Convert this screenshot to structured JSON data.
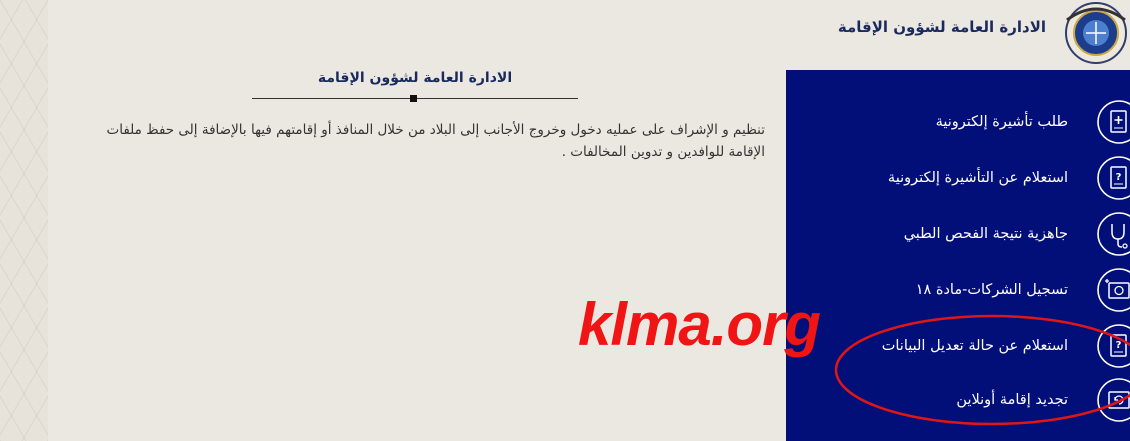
{
  "header": {
    "title": "الادارة العامة لشؤون الإقامة",
    "logo_icon": "residency-affairs-seal-icon"
  },
  "main": {
    "section_title": "الادارة العامة لشؤون الإقامة",
    "description": "تنظيم و الإشراف على عمليه دخول وخروج الأجانب إلى البلاد من خلال المنافذ أو إقامتهم فيها بالإضافة إلى حفظ ملفات الإقامة للوافدين و تدوين المخالفات ."
  },
  "sidebar": {
    "background": "#020f78",
    "items": [
      {
        "label": "طلب تأشيرة إلكترونية",
        "icon": "document-plus-icon"
      },
      {
        "label": "استعلام عن التأشيرة إلكترونية",
        "icon": "document-question-icon"
      },
      {
        "label": "جاهزية نتيجة الفحص الطبي",
        "icon": "stethoscope-icon"
      },
      {
        "label": "تسجيل الشركات-مادة ١٨",
        "icon": "company-registration-icon"
      },
      {
        "label": "استعلام عن حالة تعديل البيانات",
        "icon": "document-question-icon"
      },
      {
        "label": "تجديد إقامة أونلاين",
        "icon": "renew-id-card-icon"
      }
    ]
  },
  "watermark": {
    "text": "klma.org",
    "color": "#f01414"
  }
}
